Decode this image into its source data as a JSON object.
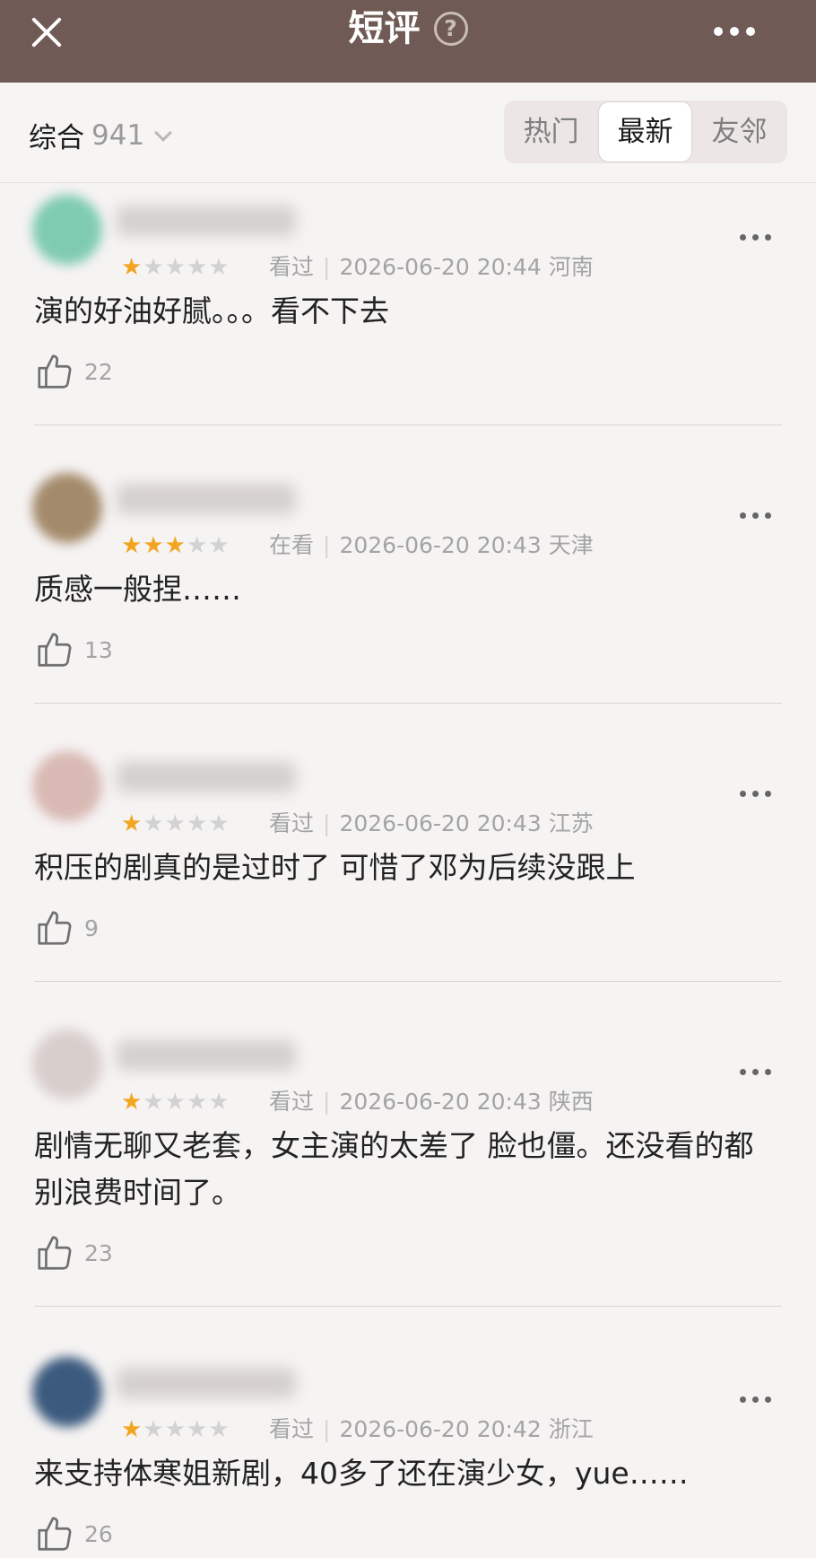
{
  "header": {
    "title": "短评",
    "help_glyph": "?"
  },
  "filter": {
    "sort_label": "综合",
    "sort_count": "941",
    "tabs": [
      {
        "label": "热门",
        "active": false
      },
      {
        "label": "最新",
        "active": true
      },
      {
        "label": "友邻",
        "active": false
      }
    ]
  },
  "reviews": [
    {
      "rating": 1,
      "status": "看过",
      "datetime": "2026-06-20 20:44",
      "location": "河南",
      "content": "演的好油好腻。。。看不下去",
      "likes": "22",
      "avatar_color": "#7fcbb2"
    },
    {
      "rating": 3,
      "status": "在看",
      "datetime": "2026-06-20 20:43",
      "location": "天津",
      "content": "质感一般捏……",
      "likes": "13",
      "avatar_color": "#a38a6a"
    },
    {
      "rating": 1,
      "status": "看过",
      "datetime": "2026-06-20 20:43",
      "location": "江苏",
      "content": "积压的剧真的是过时了 可惜了邓为后续没跟上",
      "likes": "9",
      "avatar_color": "#d9b9b3"
    },
    {
      "rating": 1,
      "status": "看过",
      "datetime": "2026-06-20 20:43",
      "location": "陕西",
      "content": "剧情无聊又老套，女主演的太差了 脸也僵。还没看的都别浪费时间了。",
      "likes": "23",
      "avatar_color": "#d8cfcd"
    },
    {
      "rating": 1,
      "status": "看过",
      "datetime": "2026-06-20 20:42",
      "location": "浙江",
      "content": "来支持体寒姐新剧，40多了还在演少女，yue……",
      "likes": "26",
      "avatar_color": "#3b5a7e"
    }
  ]
}
